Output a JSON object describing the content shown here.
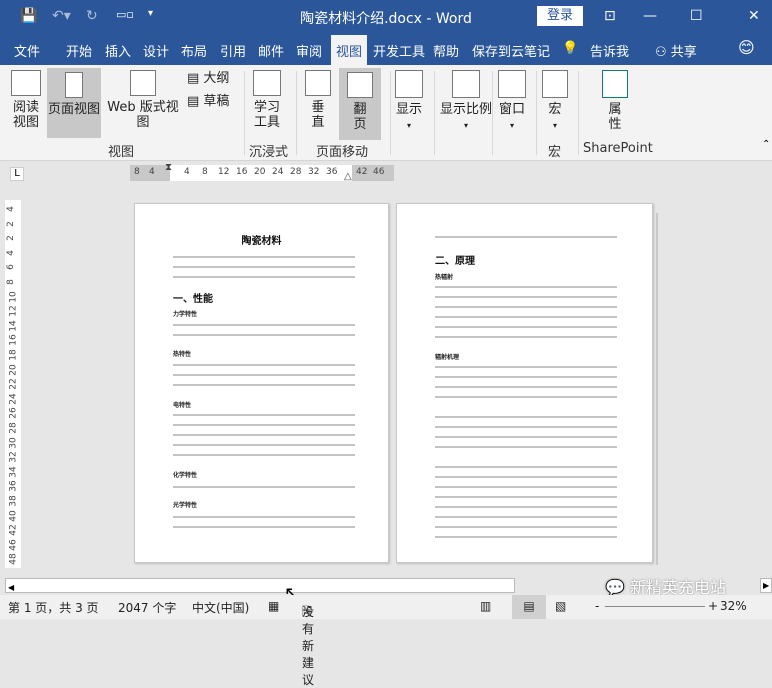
{
  "titlebar": {
    "title": "陶瓷材料介绍.docx  -  Word",
    "login": "登录",
    "colors": {
      "brand": "#2b579a"
    }
  },
  "tabs": [
    {
      "label": "文件"
    },
    {
      "label": "开始"
    },
    {
      "label": "插入"
    },
    {
      "label": "设计"
    },
    {
      "label": "布局"
    },
    {
      "label": "引用"
    },
    {
      "label": "邮件"
    },
    {
      "label": "审阅"
    },
    {
      "label": "视图",
      "active": true
    },
    {
      "label": "开发工具"
    },
    {
      "label": "帮助"
    },
    {
      "label": "保存到云笔记"
    },
    {
      "label": "告诉我"
    },
    {
      "label": "共享"
    }
  ],
  "ribbon": {
    "read_mode": "阅读\n视图",
    "print_layout": "页面视图",
    "web_layout": "Web 版式视图",
    "outline": "大纲",
    "draft": "草稿",
    "learning_tools": "学习\n工具",
    "vertical": "垂\n直",
    "side_to_side": "翻\n页",
    "show": "显示",
    "zoom": "显示比例",
    "window": "窗口",
    "macros": "宏",
    "properties": "属\n性",
    "groups": {
      "views": "视图",
      "immersive": "沉浸式",
      "page_movement": "页面移动",
      "macros": "宏",
      "sharepoint": "SharePoint"
    }
  },
  "ruler": {
    "h_ticks": [
      "8",
      "4",
      "4",
      "8",
      "12",
      "16",
      "20",
      "24",
      "28",
      "32",
      "36",
      "42",
      "46"
    ],
    "v_ticks": [
      "4",
      "2",
      "2",
      "4",
      "6",
      "8",
      "10",
      "12",
      "14",
      "16",
      "18",
      "20",
      "22",
      "24",
      "26",
      "28",
      "30",
      "32",
      "34",
      "36",
      "38",
      "40",
      "42",
      "46",
      "48"
    ]
  },
  "page1": {
    "title": "陶瓷材料",
    "h_performance": "一、性能",
    "h_mech": "力学特性",
    "h_thermal": "热特性",
    "h_elec": "电特性",
    "h_chem": "化学特性",
    "h_optical": "光学特性"
  },
  "page2": {
    "h_principle": "二、原理",
    "h_radiation": "热辐射",
    "h_mechanism": "辐射机理"
  },
  "watermark": "新精英充电站",
  "status": {
    "page": "第 1 页，共 3 页",
    "words": "2047 个字",
    "language": "中文(中国)",
    "suggestions": "没有新建议",
    "zoom": "32%"
  }
}
